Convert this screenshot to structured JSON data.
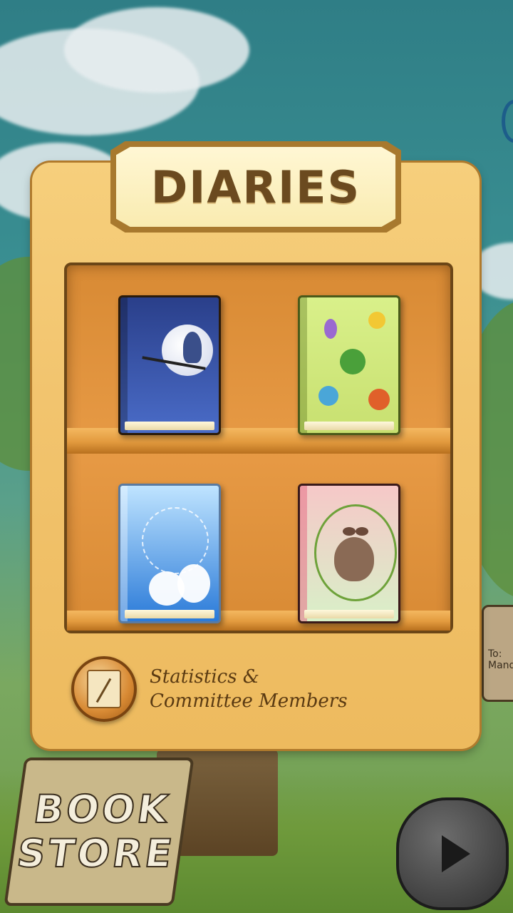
{
  "screen": {
    "title": "DIARIES"
  },
  "shelf": {
    "books": [
      {
        "name": "moon-cat-diary",
        "theme": "moonlit night with cat silhouette"
      },
      {
        "name": "flower-diary",
        "theme": "green cover with flowers"
      },
      {
        "name": "snow-diary",
        "theme": "snowy blue cover with white creatures"
      },
      {
        "name": "sprout-diary",
        "theme": "pink cover with sprout creature and vines"
      }
    ]
  },
  "stats": {
    "label_line1": "Statistics &",
    "label_line2": "Committee Members"
  },
  "sign": {
    "line1": "BOOK",
    "line2": "STORE"
  },
  "mailbox": {
    "label": "To: Mand"
  },
  "colors": {
    "panel": "#f2c46e",
    "shelf": "#e29a3e",
    "title_text": "#6b4a1f"
  }
}
